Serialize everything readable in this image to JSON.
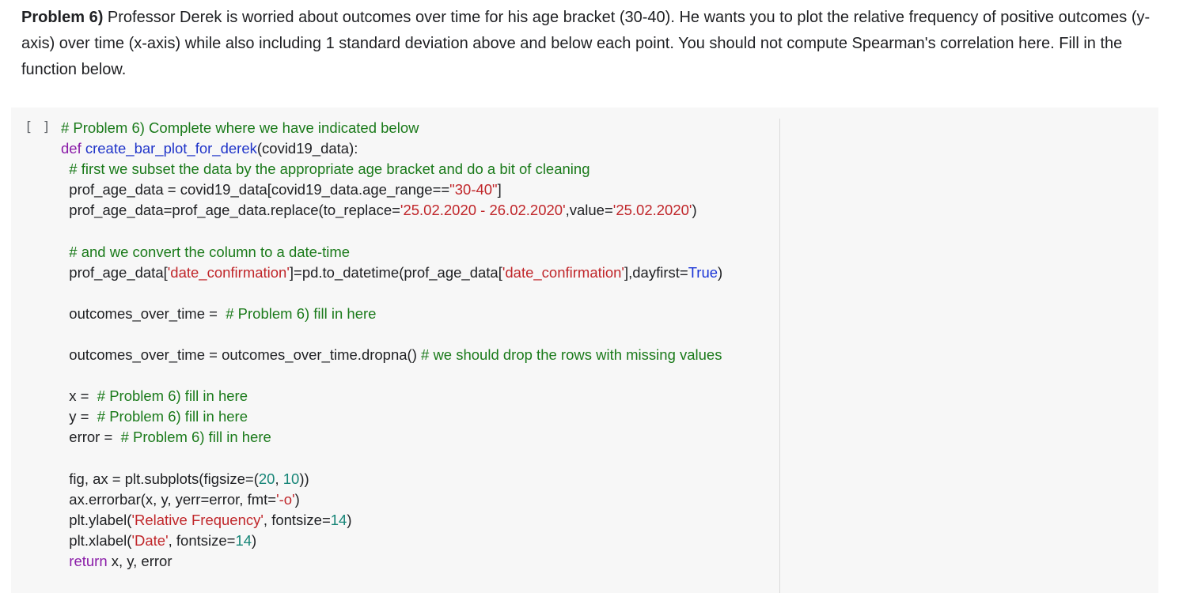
{
  "problem": {
    "label": "Problem 6)",
    "text": " Professor Derek is worried about outcomes over time for his age bracket (30-40). He wants you to plot the relative frequency of positive outcomes (y-axis) over time (x-axis) while also including 1 standard deviation above and below each point. You should not compute Spearman's correlation here. Fill in the function below."
  },
  "cell": {
    "prompt": "[ ]",
    "lines": [
      [
        [
          "comment",
          "# Problem 6) Complete where we have indicated below"
        ]
      ],
      [
        [
          "keyword",
          "def "
        ],
        [
          "fn",
          "create_bar_plot_for_derek"
        ],
        [
          "plain",
          "(covid19_data):"
        ]
      ],
      [
        [
          "plain",
          "  "
        ],
        [
          "comment",
          "# first we subset the data by the appropriate age bracket and do a bit of cleaning"
        ]
      ],
      [
        [
          "plain",
          "  prof_age_data = covid19_data[covid19_data.age_range=="
        ],
        [
          "string",
          "\"30-40\""
        ],
        [
          "plain",
          "]"
        ]
      ],
      [
        [
          "plain",
          "  prof_age_data=prof_age_data.replace(to_replace="
        ],
        [
          "string",
          "'25.02.2020 - 26.02.2020'"
        ],
        [
          "plain",
          ",value="
        ],
        [
          "string",
          "'25.02.2020'"
        ],
        [
          "plain",
          ")"
        ]
      ],
      [
        [
          "plain",
          ""
        ]
      ],
      [
        [
          "plain",
          "  "
        ],
        [
          "comment",
          "# and we convert the column to a date-time"
        ]
      ],
      [
        [
          "plain",
          "  prof_age_data["
        ],
        [
          "string",
          "'date_confirmation'"
        ],
        [
          "plain",
          "]=pd.to_datetime(prof_age_data["
        ],
        [
          "string",
          "'date_confirmation'"
        ],
        [
          "plain",
          "],dayfirst="
        ],
        [
          "const",
          "True"
        ],
        [
          "plain",
          ")"
        ]
      ],
      [
        [
          "plain",
          ""
        ]
      ],
      [
        [
          "plain",
          "  outcomes_over_time =  "
        ],
        [
          "comment",
          "# Problem 6) fill in here"
        ]
      ],
      [
        [
          "plain",
          ""
        ]
      ],
      [
        [
          "plain",
          "  outcomes_over_time = outcomes_over_time.dropna() "
        ],
        [
          "comment",
          "# we should drop the rows with missing values"
        ]
      ],
      [
        [
          "plain",
          ""
        ]
      ],
      [
        [
          "plain",
          "  x =  "
        ],
        [
          "comment",
          "# Problem 6) fill in here"
        ]
      ],
      [
        [
          "plain",
          "  y =  "
        ],
        [
          "comment",
          "# Problem 6) fill in here"
        ]
      ],
      [
        [
          "plain",
          "  error =  "
        ],
        [
          "comment",
          "# Problem 6) fill in here"
        ]
      ],
      [
        [
          "plain",
          ""
        ]
      ],
      [
        [
          "plain",
          "  fig, ax = plt.subplots(figsize=("
        ],
        [
          "number",
          "20"
        ],
        [
          "plain",
          ", "
        ],
        [
          "number",
          "10"
        ],
        [
          "plain",
          "))"
        ]
      ],
      [
        [
          "plain",
          "  ax.errorbar(x, y, yerr=error, fmt="
        ],
        [
          "string",
          "'-o'"
        ],
        [
          "plain",
          ")"
        ]
      ],
      [
        [
          "plain",
          "  plt.ylabel("
        ],
        [
          "string",
          "'Relative Frequency'"
        ],
        [
          "plain",
          ", fontsize="
        ],
        [
          "number",
          "14"
        ],
        [
          "plain",
          ")"
        ]
      ],
      [
        [
          "plain",
          "  plt.xlabel("
        ],
        [
          "string",
          "'Date'"
        ],
        [
          "plain",
          ", fontsize="
        ],
        [
          "number",
          "14"
        ],
        [
          "plain",
          ")"
        ]
      ],
      [
        [
          "plain",
          "  "
        ],
        [
          "keyword",
          "return"
        ],
        [
          "plain",
          " x, y, error"
        ]
      ]
    ]
  }
}
